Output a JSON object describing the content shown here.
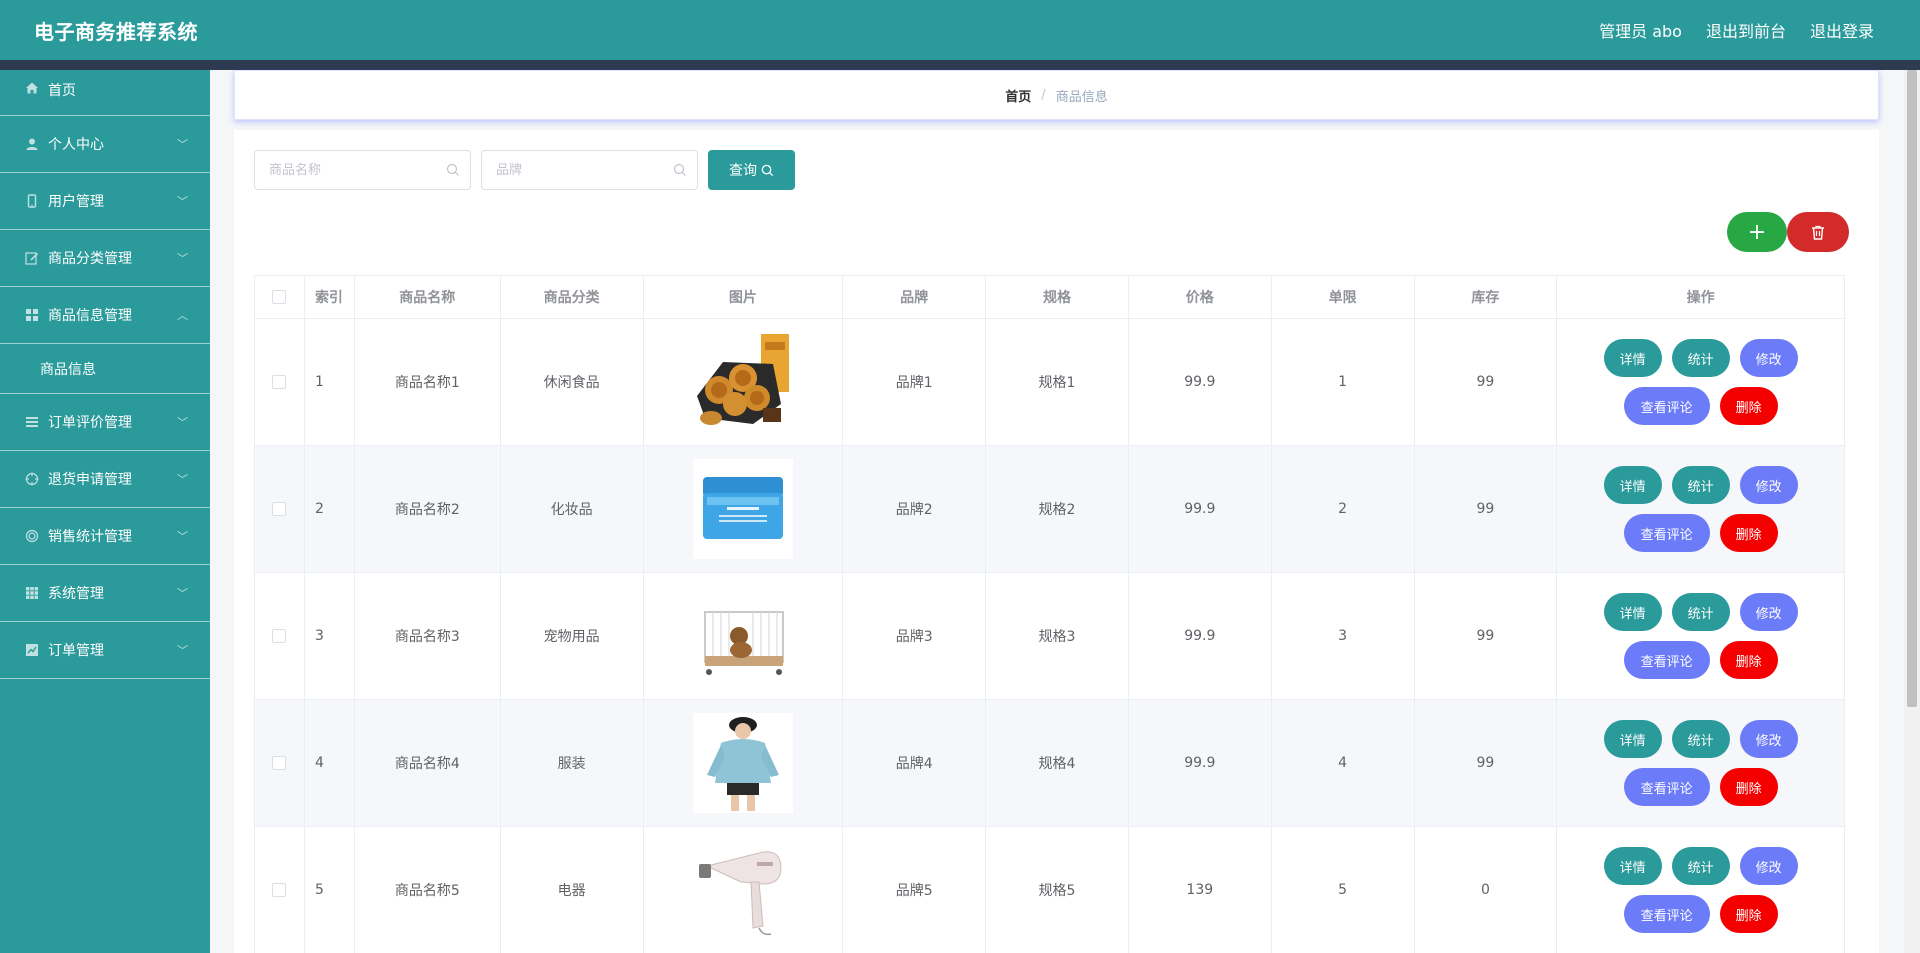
{
  "header": {
    "app_title": "电子商务推荐系统",
    "user_label": "管理员 abo",
    "to_frontend": "退出到前台",
    "logout": "退出登录"
  },
  "sidebar": {
    "items": [
      {
        "label": "首页",
        "icon": "home-icon"
      },
      {
        "label": "个人中心",
        "icon": "user-icon"
      },
      {
        "label": "用户管理",
        "icon": "phone-icon"
      },
      {
        "label": "商品分类管理",
        "icon": "edit-icon"
      },
      {
        "label": "商品信息管理",
        "icon": "grid-icon"
      },
      {
        "label": "商品信息",
        "icon": ""
      },
      {
        "label": "订单评价管理",
        "icon": "list-icon"
      },
      {
        "label": "退货申请管理",
        "icon": "target-icon"
      },
      {
        "label": "销售统计管理",
        "icon": "circle-icon"
      },
      {
        "label": "系统管理",
        "icon": "apps-icon"
      },
      {
        "label": "订单管理",
        "icon": "chart-icon"
      }
    ]
  },
  "breadcrumb": {
    "home": "首页",
    "separator": "/",
    "current": "商品信息"
  },
  "search": {
    "name_placeholder": "商品名称",
    "brand_placeholder": "品牌",
    "query_label": "查询"
  },
  "toolbar": {
    "add_symbol": "+"
  },
  "table": {
    "headers": {
      "index": "索引",
      "name": "商品名称",
      "category": "商品分类",
      "image": "图片",
      "brand": "品牌",
      "spec": "规格",
      "price": "价格",
      "limit": "单限",
      "stock": "库存",
      "ops": "操作"
    },
    "rows": [
      {
        "index": "1",
        "name": "商品名称1",
        "category": "休闲食品",
        "image": "snack-image",
        "brand": "品牌1",
        "spec": "规格1",
        "price": "99.9",
        "limit": "1",
        "stock": "99"
      },
      {
        "index": "2",
        "name": "商品名称2",
        "category": "化妆品",
        "image": "cosmetic-jar-image",
        "brand": "品牌2",
        "spec": "规格2",
        "price": "99.9",
        "limit": "2",
        "stock": "99"
      },
      {
        "index": "3",
        "name": "商品名称3",
        "category": "宠物用品",
        "image": "pet-cage-image",
        "brand": "品牌3",
        "spec": "规格3",
        "price": "99.9",
        "limit": "3",
        "stock": "99"
      },
      {
        "index": "4",
        "name": "商品名称4",
        "category": "服装",
        "image": "hoodie-image",
        "brand": "品牌4",
        "spec": "规格4",
        "price": "99.9",
        "limit": "4",
        "stock": "99"
      },
      {
        "index": "5",
        "name": "商品名称5",
        "category": "电器",
        "image": "hair-dryer-image",
        "brand": "品牌5",
        "spec": "规格5",
        "price": "139",
        "limit": "5",
        "stock": "0"
      }
    ],
    "ops": {
      "detail": "详情",
      "stats": "统计",
      "edit": "修改",
      "review": "查看评论",
      "delete": "删除"
    }
  },
  "colors": {
    "primary": "#2a9a9b",
    "header_strip": "#2e3a4f",
    "add": "#27a844",
    "delete_all": "#d32a2a",
    "edit": "#6c7cf8",
    "delete": "#f50000"
  }
}
